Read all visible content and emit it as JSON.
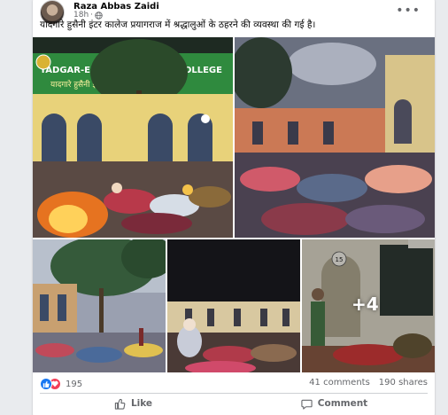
{
  "post": {
    "author": "Raza Abbas Zaidi",
    "time": "18h",
    "separator": "·",
    "caption": "यादगारे  हुसैनी इंटर कालेज प्रयागराज में श्रद्धालुओं के ठहरने की व्यवस्था की गई है।",
    "sign_school_en": "YADGAR-E-HUSSAINI INTER COLLEGE",
    "sign_school_hi": "यादगारे हुसैनी इन्टर कालेज",
    "room_number": "15",
    "extra_photos_label": "+4"
  },
  "engagement": {
    "reaction_count": "195",
    "comments": "41 comments",
    "shares": "190 shares"
  },
  "actions": {
    "like": "Like",
    "comment": "Comment"
  },
  "icons": {
    "privacy": "globe-icon",
    "more": "more-options-icon",
    "like_reaction": "thumbs-up-icon",
    "love_reaction": "heart-icon",
    "like_action": "thumbs-up-outline-icon",
    "comment_action": "speech-bubble-icon"
  },
  "colors": {
    "accent": "#1877f2",
    "love": "#f33e58",
    "muted_text": "#65676b"
  }
}
